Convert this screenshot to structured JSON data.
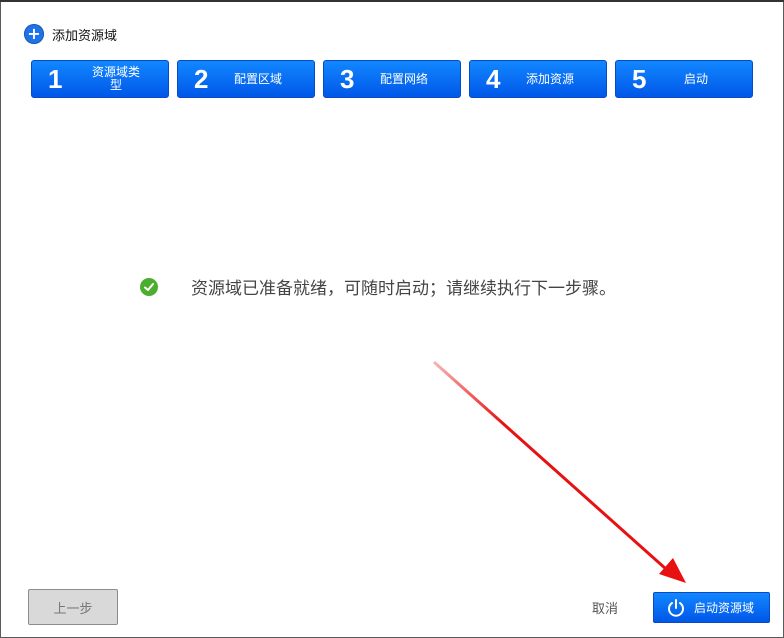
{
  "dialog": {
    "title": "添加资源域",
    "title_icon": "plus-circle-icon"
  },
  "steps": [
    {
      "number": "1",
      "label": "资源域类型"
    },
    {
      "number": "2",
      "label": "配置区域"
    },
    {
      "number": "3",
      "label": "配置网络"
    },
    {
      "number": "4",
      "label": "添加资源"
    },
    {
      "number": "5",
      "label": "启动"
    }
  ],
  "main": {
    "status_icon": "check-circle-icon",
    "message": "资源域已准备就绪，可随时启动；请继续执行下一步骤。"
  },
  "footer": {
    "prev_label": "上一步",
    "cancel_label": "取消",
    "start_label": "启动资源域",
    "start_icon": "power-icon"
  },
  "colors": {
    "accent": "#0a6ef5",
    "success": "#4cae2f",
    "arrow": "#e81010"
  }
}
